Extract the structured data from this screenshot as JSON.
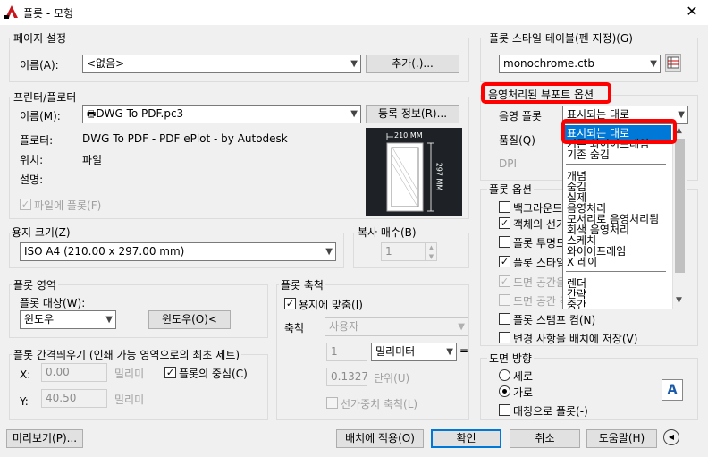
{
  "window": {
    "title": "플롯 - 모형",
    "close": "✕"
  },
  "page_setup": {
    "group": "페이지 설정",
    "name_label": "이름(A):",
    "name_value": "<없음>",
    "add_btn": "추가(.)..."
  },
  "printer": {
    "group": "프린터/플로터",
    "name_label": "이름(M):",
    "name_value": "DWG To PDF.pc3",
    "props_btn": "등록 정보(R)...",
    "plotter_label": "플로터:",
    "plotter_value": "DWG To PDF - PDF ePlot - by Autodesk",
    "where_label": "위치:",
    "where_value": "파일",
    "desc_label": "설명:",
    "plot_to_file": "파일에 플롯(F)",
    "preview": {
      "width_dim": "210 MM",
      "height_dim": "297 MM"
    }
  },
  "paper_size": {
    "label": "용지 크기(Z)",
    "value": "ISO A4 (210.00 x 297.00 mm)"
  },
  "copies": {
    "label": "복사 매수(B)",
    "value": "1"
  },
  "plot_area": {
    "group": "플롯 영역",
    "what_label": "플롯 대상(W):",
    "what_value": "윈도우",
    "window_btn": "윈도우(O)<"
  },
  "plot_offset": {
    "group": "플롯 간격띄우기 (인쇄 가능 영역으로의 최초 세트)",
    "x_label": "X:",
    "x_value": "0.00",
    "x_unit": "밀리미",
    "y_label": "Y:",
    "y_value": "40.50",
    "y_unit": "밀리미",
    "center": "플롯의 중심(C)"
  },
  "plot_scale": {
    "group": "플롯 축척",
    "fit": "용지에 맞춤(I)",
    "scale_label": "축척",
    "scale_value": "사용자",
    "num_value": "1",
    "unit_value": "밀리미터",
    "eq": "=",
    "denom_value": "0.1327",
    "denom_unit": "단위(U)",
    "lineweights": "선가중치 축척(L)"
  },
  "plot_style": {
    "group": "플롯 스타일 테이블(펜 지정)(G)",
    "value": "monochrome.ctb"
  },
  "shaded": {
    "group": "음영처리된 뷰포트 옵션",
    "shade_label": "음영 플롯",
    "shade_value": "표시되는 대로",
    "quality_label": "품질(Q)",
    "dpi_label": "DPI"
  },
  "dropdown": {
    "selected": "표시되는 대로",
    "items": [
      "표시되는 대로",
      "기존 와이어프레임",
      "기존 숨김",
      "개념",
      "숨김",
      "실제",
      "음영처리",
      "모서리로 음영처리됨",
      "회색 음영처리",
      "스케치",
      "와이어프레임",
      "X 레이",
      "렌더",
      "간략",
      "중간"
    ]
  },
  "plot_options": {
    "group": "플롯 옵션",
    "items": [
      "백그라운드",
      "객체의 선가",
      "플롯 투명도",
      "플롯 스타일",
      "도면 공간을",
      "도면 공간 객",
      "플롯 스탬프 켬(N)",
      "변경 사항을 배치에 저장(V)"
    ]
  },
  "orientation": {
    "group": "도면 방향",
    "portrait": "세로",
    "landscape": "가로",
    "upside_down": "대칭으로 플롯(-)",
    "icon": "A"
  },
  "footer": {
    "preview_btn": "미리보기(P)...",
    "apply_btn": "배치에 적용(O)",
    "ok_btn": "확인",
    "cancel_btn": "취소",
    "help_btn": "도움말(H)",
    "collapse": "◀"
  },
  "colors": {
    "highlight": "#ff0000",
    "selection": "#0078d7"
  }
}
